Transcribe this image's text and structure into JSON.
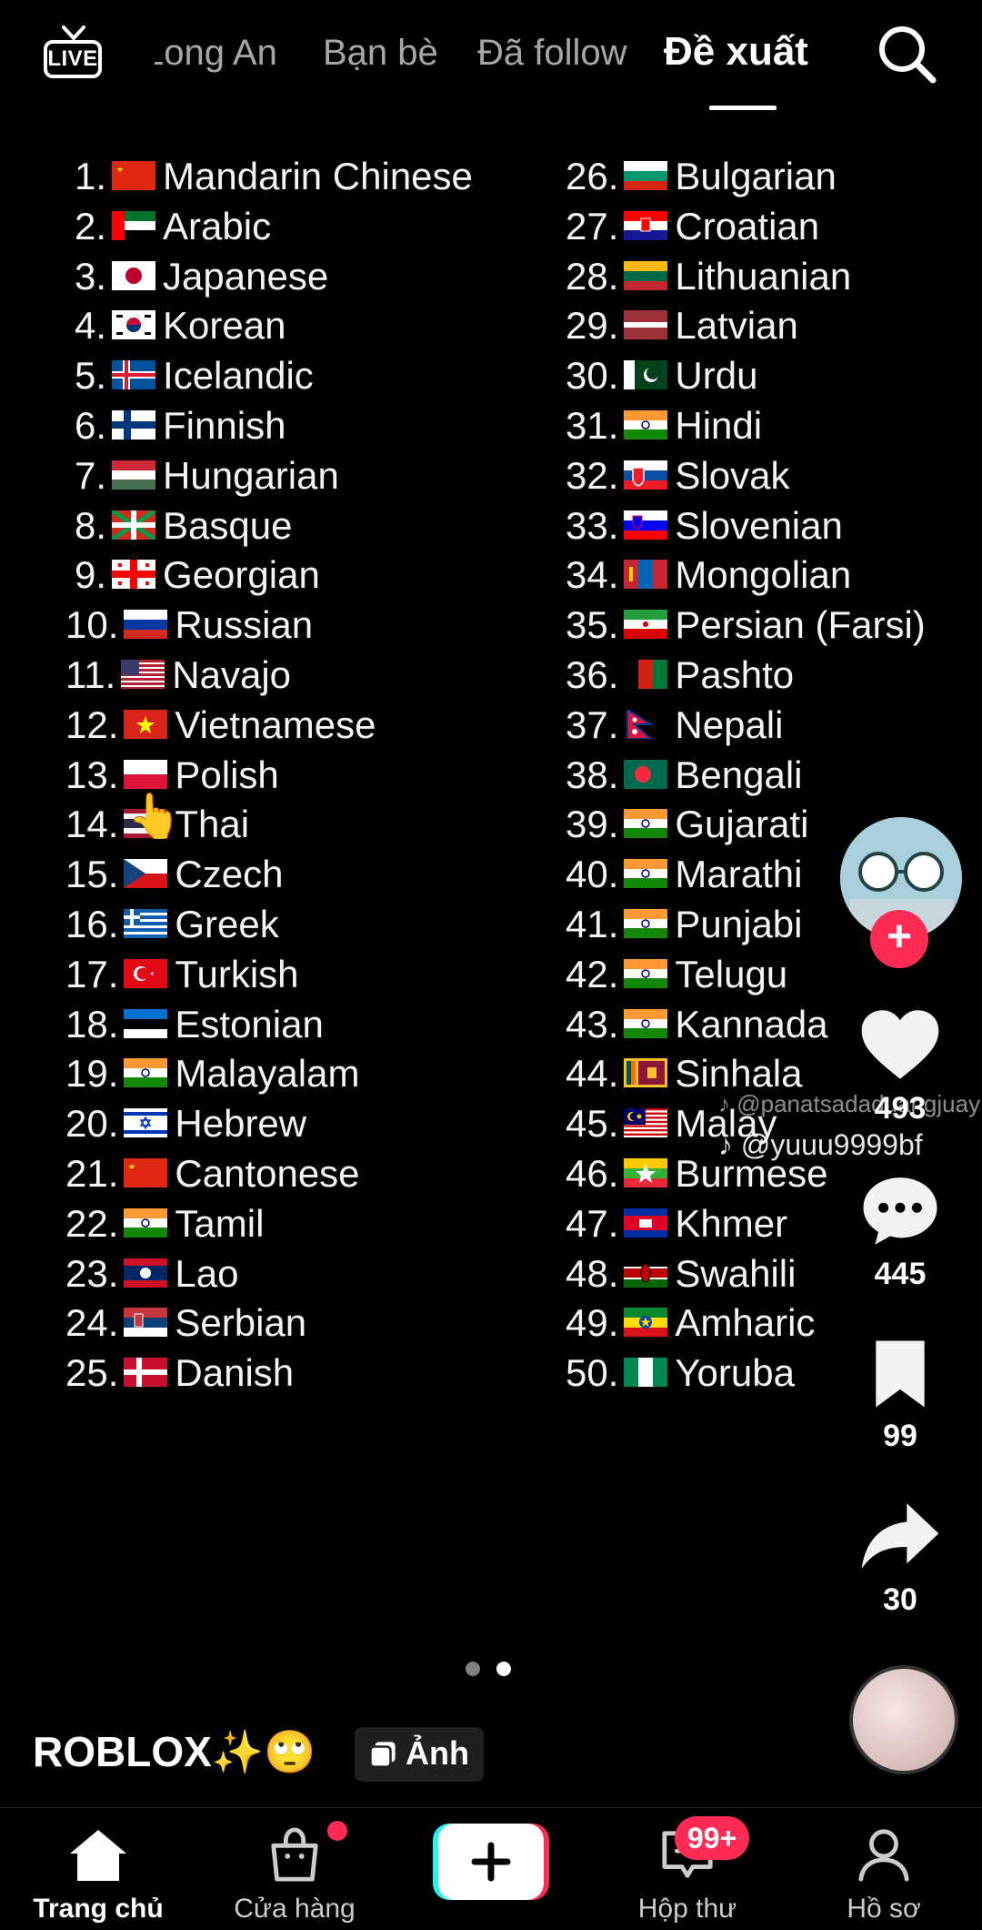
{
  "top_nav": {
    "live_label": "LIVE",
    "tabs": [
      {
        "label": "Long An"
      },
      {
        "label": "Bạn bè"
      },
      {
        "label": "Đã follow"
      },
      {
        "label": "Đề xuất"
      }
    ],
    "active_tab": "Đề xuất"
  },
  "languages": [
    {
      "num": "1.",
      "name": "Mandarin Chinese",
      "flag": "cn"
    },
    {
      "num": "2.",
      "name": "Arabic",
      "flag": "ae"
    },
    {
      "num": "3.",
      "name": "Japanese",
      "flag": "jp"
    },
    {
      "num": "4.",
      "name": "Korean",
      "flag": "kr"
    },
    {
      "num": "5.",
      "name": "Icelandic",
      "flag": "is"
    },
    {
      "num": "6.",
      "name": "Finnish",
      "flag": "fi"
    },
    {
      "num": "7.",
      "name": "Hungarian",
      "flag": "hu"
    },
    {
      "num": "8.",
      "name": "Basque",
      "flag": "eu"
    },
    {
      "num": "9.",
      "name": "Georgian",
      "flag": "ge"
    },
    {
      "num": "10.",
      "name": "Russian",
      "flag": "ru"
    },
    {
      "num": "11.",
      "name": "Navajo",
      "flag": "us"
    },
    {
      "num": "12.",
      "name": "Vietnamese",
      "flag": "vn"
    },
    {
      "num": "13.",
      "name": "Polish",
      "flag": "pl"
    },
    {
      "num": "14.",
      "name": "Thai",
      "flag": "th"
    },
    {
      "num": "15.",
      "name": "Czech",
      "flag": "cz"
    },
    {
      "num": "16.",
      "name": "Greek",
      "flag": "gr"
    },
    {
      "num": "17.",
      "name": "Turkish",
      "flag": "tr"
    },
    {
      "num": "18.",
      "name": "Estonian",
      "flag": "ee"
    },
    {
      "num": "19.",
      "name": "Malayalam",
      "flag": "in"
    },
    {
      "num": "20.",
      "name": "Hebrew",
      "flag": "il"
    },
    {
      "num": "21.",
      "name": "Cantonese",
      "flag": "cn"
    },
    {
      "num": "22.",
      "name": "Tamil",
      "flag": "in"
    },
    {
      "num": "23.",
      "name": "Lao",
      "flag": "la"
    },
    {
      "num": "24.",
      "name": "Serbian",
      "flag": "rs"
    },
    {
      "num": "25.",
      "name": "Danish",
      "flag": "dk"
    },
    {
      "num": "26.",
      "name": "Bulgarian",
      "flag": "bg"
    },
    {
      "num": "27.",
      "name": "Croatian",
      "flag": "hr"
    },
    {
      "num": "28.",
      "name": "Lithuanian",
      "flag": "lt"
    },
    {
      "num": "29.",
      "name": "Latvian",
      "flag": "lv"
    },
    {
      "num": "30.",
      "name": "Urdu",
      "flag": "pk"
    },
    {
      "num": "31.",
      "name": "Hindi",
      "flag": "in"
    },
    {
      "num": "32.",
      "name": "Slovak",
      "flag": "sk"
    },
    {
      "num": "33.",
      "name": "Slovenian",
      "flag": "si"
    },
    {
      "num": "34.",
      "name": "Mongolian",
      "flag": "mn"
    },
    {
      "num": "35.",
      "name": "Persian (Farsi)",
      "flag": "ir"
    },
    {
      "num": "36.",
      "name": "Pashto",
      "flag": "af"
    },
    {
      "num": "37.",
      "name": "Nepali",
      "flag": "np"
    },
    {
      "num": "38.",
      "name": "Bengali",
      "flag": "bd"
    },
    {
      "num": "39.",
      "name": "Gujarati",
      "flag": "in"
    },
    {
      "num": "40.",
      "name": "Marathi",
      "flag": "in"
    },
    {
      "num": "41.",
      "name": "Punjabi",
      "flag": "in"
    },
    {
      "num": "42.",
      "name": "Telugu",
      "flag": "in"
    },
    {
      "num": "43.",
      "name": "Kannada",
      "flag": "in"
    },
    {
      "num": "44.",
      "name": "Sinhala",
      "flag": "lk"
    },
    {
      "num": "45.",
      "name": "Malay",
      "flag": "my"
    },
    {
      "num": "46.",
      "name": "Burmese",
      "flag": "mm"
    },
    {
      "num": "47.",
      "name": "Khmer",
      "flag": "kh"
    },
    {
      "num": "48.",
      "name": "Swahili",
      "flag": "ke"
    },
    {
      "num": "49.",
      "name": "Amharic",
      "flag": "et"
    },
    {
      "num": "50.",
      "name": "Yoruba",
      "flag": "ng"
    }
  ],
  "watermark": {
    "line1": "@panatsadaduangjuay",
    "line2": "@yuuu9999bf"
  },
  "actions": {
    "likes": "493",
    "comments": "445",
    "saves": "99",
    "shares": "30"
  },
  "post": {
    "caption": "ROBLOX✨🙄",
    "photo_badge": "Ảnh",
    "hand_emoji": "👆"
  },
  "carousel": {
    "count": 2,
    "active_index": 1
  },
  "bottom_nav": {
    "home": "Trang chủ",
    "shop": "Cửa hàng",
    "inbox": "Hộp thư",
    "inbox_badge": "99+",
    "profile": "Hồ sơ"
  },
  "colors": {
    "accent": "#fe2c55",
    "cyan": "#25f4ee",
    "background": "#000000"
  }
}
